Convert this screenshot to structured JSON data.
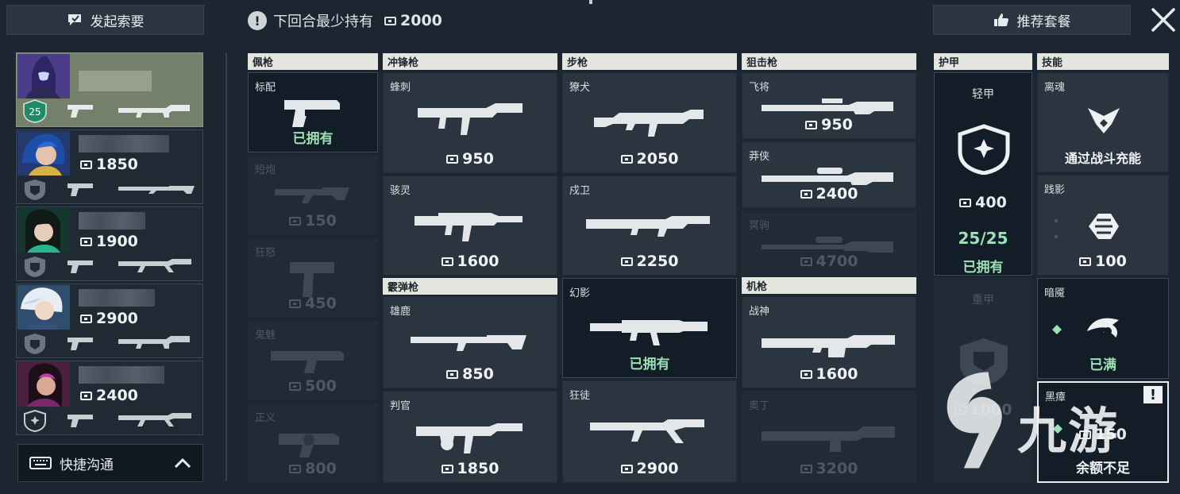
{
  "top": {
    "request_label": "发起索要",
    "min_credits_label": "下回合最少持有",
    "min_credits_value": "2000",
    "recommend_label": "推荐套餐"
  },
  "players": [
    {
      "credits": "",
      "level": "25",
      "is_me": true
    },
    {
      "credits": "1850"
    },
    {
      "credits": "1900"
    },
    {
      "credits": "2900"
    },
    {
      "credits": "2400"
    }
  ],
  "quick_comm": {
    "label": "快捷沟通"
  },
  "owned_text": "已拥有",
  "categories": {
    "sidearm": "佩枪",
    "smg": "冲锋枪",
    "rifle": "步枪",
    "sniper": "狙击枪",
    "shotgun": "霰弹枪",
    "machinegun": "机枪",
    "armor": "护甲",
    "abilities": "技能"
  },
  "weapons": {
    "classic": {
      "name": "标配",
      "status": "已拥有"
    },
    "shorty": {
      "name": "短炮",
      "price": "150"
    },
    "frenzy": {
      "name": "狂怒",
      "price": "450"
    },
    "ghost": {
      "name": "鬼魅",
      "price": "500"
    },
    "sheriff": {
      "name": "正义",
      "price": "800"
    },
    "stinger": {
      "name": "蜂刺",
      "price": "950"
    },
    "spectre": {
      "name": "骇灵",
      "price": "1600"
    },
    "bucky": {
      "name": "雄鹿",
      "price": "850"
    },
    "judge": {
      "name": "判官",
      "price": "1850"
    },
    "bulldog": {
      "name": "獠犬",
      "price": "2050"
    },
    "guardian": {
      "name": "戍卫",
      "price": "2250"
    },
    "phantom": {
      "name": "幻影",
      "status": "已拥有"
    },
    "vandal": {
      "name": "狂徒",
      "price": "2900"
    },
    "marshal": {
      "name": "飞将",
      "price": "950"
    },
    "outlaw": {
      "name": "莽侠",
      "price": "2400"
    },
    "operator": {
      "name": "冥驹",
      "price": "4700"
    },
    "ares": {
      "name": "战神",
      "price": "1600"
    },
    "odin": {
      "name": "奥丁",
      "price": "3200"
    }
  },
  "armor": {
    "light": {
      "name": "轻甲",
      "price": "400",
      "amount": "25/25",
      "status": "已拥有"
    },
    "heavy": {
      "name": "重甲",
      "price": "1000"
    }
  },
  "abilities": [
    {
      "name": "离魂",
      "status": "通过战斗充能",
      "icon": "soul-icon"
    },
    {
      "name": "践影",
      "price": "100",
      "icon": "dash-icon"
    },
    {
      "name": "暗魇",
      "status": "已满",
      "icon": "dismiss-icon"
    },
    {
      "name": "黑瘴",
      "price": "150",
      "status": "余额不足",
      "icon": "vent-icon"
    }
  ],
  "watermark": {
    "text": "九游"
  },
  "colors": {
    "background": "#1b2631",
    "owned_green": "#9ee0b6",
    "header": "#e4e5df"
  }
}
